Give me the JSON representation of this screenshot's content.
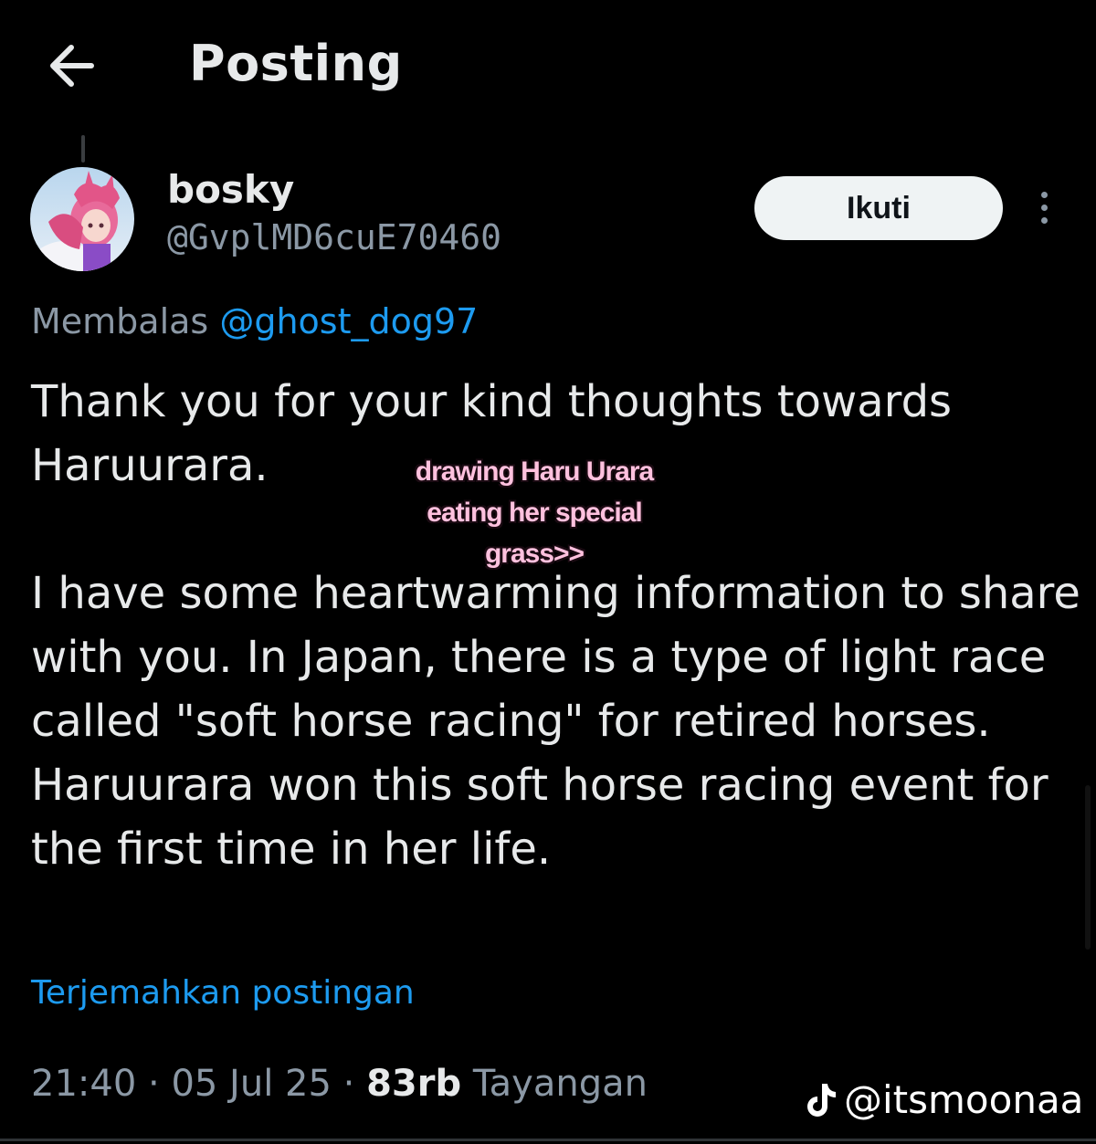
{
  "header": {
    "title": "Posting",
    "back_icon": "arrow-left-icon"
  },
  "author": {
    "display_name": "bosky",
    "handle": "@GvplMD6cuE70460",
    "follow_label": "Ikuti",
    "more_icon": "more-vertical-icon"
  },
  "reply": {
    "prefix": "Membalas",
    "mention": "@ghost_dog97"
  },
  "tweet": {
    "paragraphs": [
      "Thank you for your kind thoughts towards Haruurara.",
      "",
      "I have some heartwarming information to share with you. In Japan, there is a type of light race called \"soft horse racing\" for retired horses.",
      "Haruurara won this soft horse racing event for the first time in her life."
    ]
  },
  "overlay": {
    "lines": [
      "drawing Haru Urara",
      "eating her special",
      "grass>>"
    ]
  },
  "translate_label": "Terjemahkan postingan",
  "meta": {
    "time": "21:40",
    "date": "05 Jul 25",
    "views_count": "83rb",
    "views_label": "Tayangan"
  },
  "watermark": {
    "text": "@itsmoonaa",
    "icon": "tiktok-icon"
  },
  "colors": {
    "background": "#000000",
    "text_primary": "#e7e9ea",
    "text_secondary": "#8b98a5",
    "link": "#1d9bf0",
    "button_bg": "#eff3f4",
    "caption_pink": "#ffc1de"
  }
}
